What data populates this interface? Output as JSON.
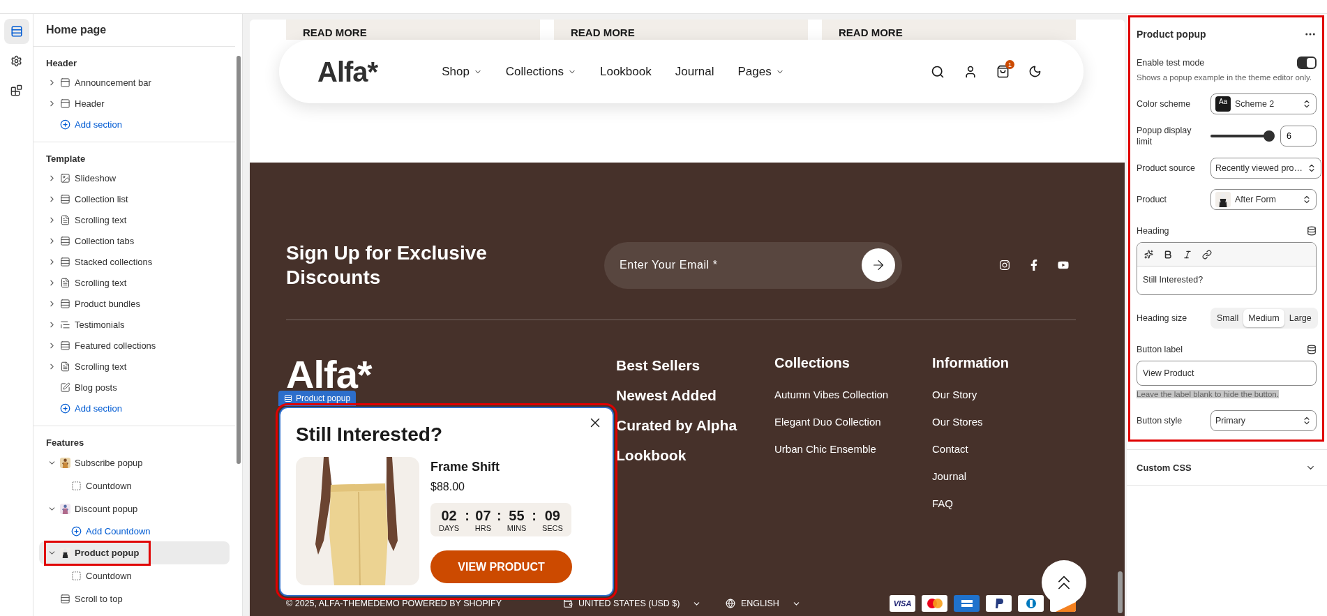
{
  "editor_rail": {
    "items": [
      {
        "kind": "sections",
        "selected": true
      },
      {
        "kind": "settings",
        "selected": false
      },
      {
        "kind": "apps",
        "selected": false
      }
    ]
  },
  "sidebar": {
    "title": "Home page",
    "groups": [
      {
        "title": "Header",
        "add_label": "Add section",
        "items": [
          {
            "kind": "bar",
            "label": "Announcement bar",
            "expanded": false,
            "selected": false
          },
          {
            "kind": "bar",
            "label": "Header",
            "expanded": false,
            "selected": false
          }
        ]
      },
      {
        "title": "Template",
        "add_label": "Add section",
        "items": [
          {
            "kind": "slideshow",
            "label": "Slideshow",
            "expanded": false,
            "selected": false
          },
          {
            "kind": "section",
            "label": "Collection list",
            "expanded": false,
            "selected": false
          },
          {
            "kind": "text",
            "label": "Scrolling text",
            "expanded": false,
            "selected": false
          },
          {
            "kind": "section",
            "label": "Collection tabs",
            "expanded": false,
            "selected": false
          },
          {
            "kind": "section",
            "label": "Stacked collections",
            "expanded": false,
            "selected": false
          },
          {
            "kind": "text",
            "label": "Scrolling text",
            "expanded": false,
            "selected": false
          },
          {
            "kind": "section",
            "label": "Product bundles",
            "expanded": false,
            "selected": false
          },
          {
            "kind": "quote",
            "label": "Testimonials",
            "expanded": false,
            "selected": false
          },
          {
            "kind": "section",
            "label": "Featured collections",
            "expanded": false,
            "selected": false
          },
          {
            "kind": "text",
            "label": "Scrolling text",
            "expanded": false,
            "selected": false
          },
          {
            "kind": "blog",
            "label": "Blog posts",
            "selected": false
          }
        ]
      },
      {
        "title": "Features",
        "items": [
          {
            "kind": "thumb",
            "label": "Subscribe popup",
            "expanded": true,
            "selected": false,
            "children": [
              {
                "kind": "countdown",
                "label": "Countdown"
              }
            ]
          },
          {
            "kind": "thumb",
            "label": "Discount popup",
            "expanded": true,
            "selected": false,
            "children": [
              {
                "kind": "add",
                "label": "Add Countdown"
              }
            ]
          },
          {
            "kind": "thumb",
            "label": "Product popup",
            "expanded": true,
            "selected": true,
            "outlined": true,
            "children": [
              {
                "kind": "countdown",
                "label": "Countdown"
              }
            ]
          },
          {
            "kind": "section",
            "label": "Scroll to top",
            "selected": false
          }
        ]
      }
    ]
  },
  "preview": {
    "cards": [
      "READ MORE",
      "READ MORE",
      "READ MORE"
    ],
    "nav": {
      "logo": "Alfa*",
      "links": [
        {
          "label": "Shop",
          "dropdown": true
        },
        {
          "label": "Collections",
          "dropdown": true
        },
        {
          "label": "Lookbook",
          "dropdown": false
        },
        {
          "label": "Journal",
          "dropdown": false
        },
        {
          "label": "Pages",
          "dropdown": true
        }
      ],
      "cart_count": "1"
    },
    "footer": {
      "signup_title": "Sign Up for Exclusive Discounts",
      "email_placeholder": "Enter Your Email *",
      "logo": "Alfa*",
      "menu": [
        "Best Sellers",
        "Newest Added",
        "Curated by Alpha",
        "Lookbook"
      ],
      "columns": [
        {
          "title": "Collections",
          "links": [
            "Autumn Vibes Collection",
            "Elegant Duo Collection",
            "Urban Chic Ensemble"
          ]
        },
        {
          "title": "Information",
          "links": [
            "Our Story",
            "Our Stores",
            "Contact",
            "Journal",
            "FAQ"
          ]
        }
      ],
      "copyright": "© 2025, ALFA-THEMEDEMO POWERED BY SHOPIFY",
      "country": "UNITED STATES (USD $)",
      "language": "ENGLISH",
      "payments": [
        {
          "kind": "visa",
          "label": "VISA"
        },
        {
          "kind": "mastercard"
        },
        {
          "kind": "amex"
        },
        {
          "kind": "paypal"
        },
        {
          "kind": "diners"
        },
        {
          "kind": "discover"
        }
      ]
    },
    "popup": {
      "tag": "Product popup",
      "outlined": true,
      "heading": "Still Interested?",
      "product": "Frame Shift",
      "price": "$88.00",
      "countdown": {
        "separator": ":",
        "units": [
          {
            "value": "02",
            "unit": "DAYS"
          },
          {
            "value": "07",
            "unit": "HRS"
          },
          {
            "value": "55",
            "unit": "MINS"
          },
          {
            "value": "09",
            "unit": "SECS"
          }
        ]
      },
      "button": "VIEW PRODUCT"
    }
  },
  "settings": {
    "title": "Product popup",
    "outlined": true,
    "fields": [
      {
        "kind": "toggle",
        "label": "Enable test mode",
        "on": true,
        "help": "Shows a popup example in the theme editor only."
      },
      {
        "kind": "select",
        "label": "Color scheme",
        "value": "Scheme 2",
        "thumb_text": "Aa"
      },
      {
        "kind": "range",
        "label": "Popup display limit",
        "level": 1,
        "value": "6"
      },
      {
        "kind": "select",
        "label": "Product source",
        "value": "Recently viewed pro…"
      },
      {
        "kind": "select",
        "label": "Product",
        "value": "After Form",
        "has_thumbnail": true
      },
      {
        "kind": "richtext",
        "label": "Heading",
        "value": "Still Interested?",
        "dynamic_source": true
      },
      {
        "kind": "segmented",
        "label": "Heading size",
        "options": [
          {
            "label": "Small",
            "selected": false
          },
          {
            "label": "Medium",
            "selected": true
          },
          {
            "label": "Large",
            "selected": false
          }
        ]
      },
      {
        "kind": "text",
        "label": "Button label",
        "value": "View Product",
        "dynamic_source": true,
        "help": "Leave the label blank to hide the button.",
        "help_highlighted": true
      },
      {
        "kind": "select",
        "label": "Button style",
        "value": "Primary"
      }
    ],
    "custom_css": "Custom CSS"
  }
}
